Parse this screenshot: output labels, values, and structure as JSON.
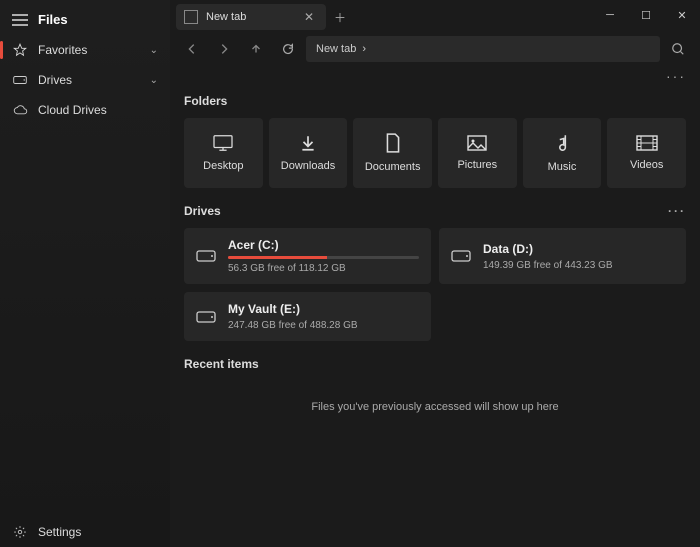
{
  "app": {
    "title": "Files"
  },
  "sidebar": {
    "items": [
      {
        "label": "Favorites"
      },
      {
        "label": "Drives"
      },
      {
        "label": "Cloud Drives"
      }
    ],
    "settings": "Settings"
  },
  "tab": {
    "title": "New tab"
  },
  "path": {
    "crumb": "New tab"
  },
  "sections": {
    "folders": "Folders",
    "drives": "Drives",
    "recent": "Recent items"
  },
  "folders": [
    {
      "label": "Desktop"
    },
    {
      "label": "Downloads"
    },
    {
      "label": "Documents"
    },
    {
      "label": "Pictures"
    },
    {
      "label": "Music"
    },
    {
      "label": "Videos"
    }
  ],
  "drives": [
    {
      "name": "Acer (C:)",
      "free": "56.3 GB free of 118.12 GB",
      "pct": 52
    },
    {
      "name": "Data (D:)",
      "free": "149.39 GB free of 443.23 GB",
      "pct": 0
    },
    {
      "name": "My Vault (E:)",
      "free": "247.48 GB free of 488.28 GB",
      "pct": 0
    }
  ],
  "recent": {
    "empty": "Files you've previously accessed will show up here"
  }
}
